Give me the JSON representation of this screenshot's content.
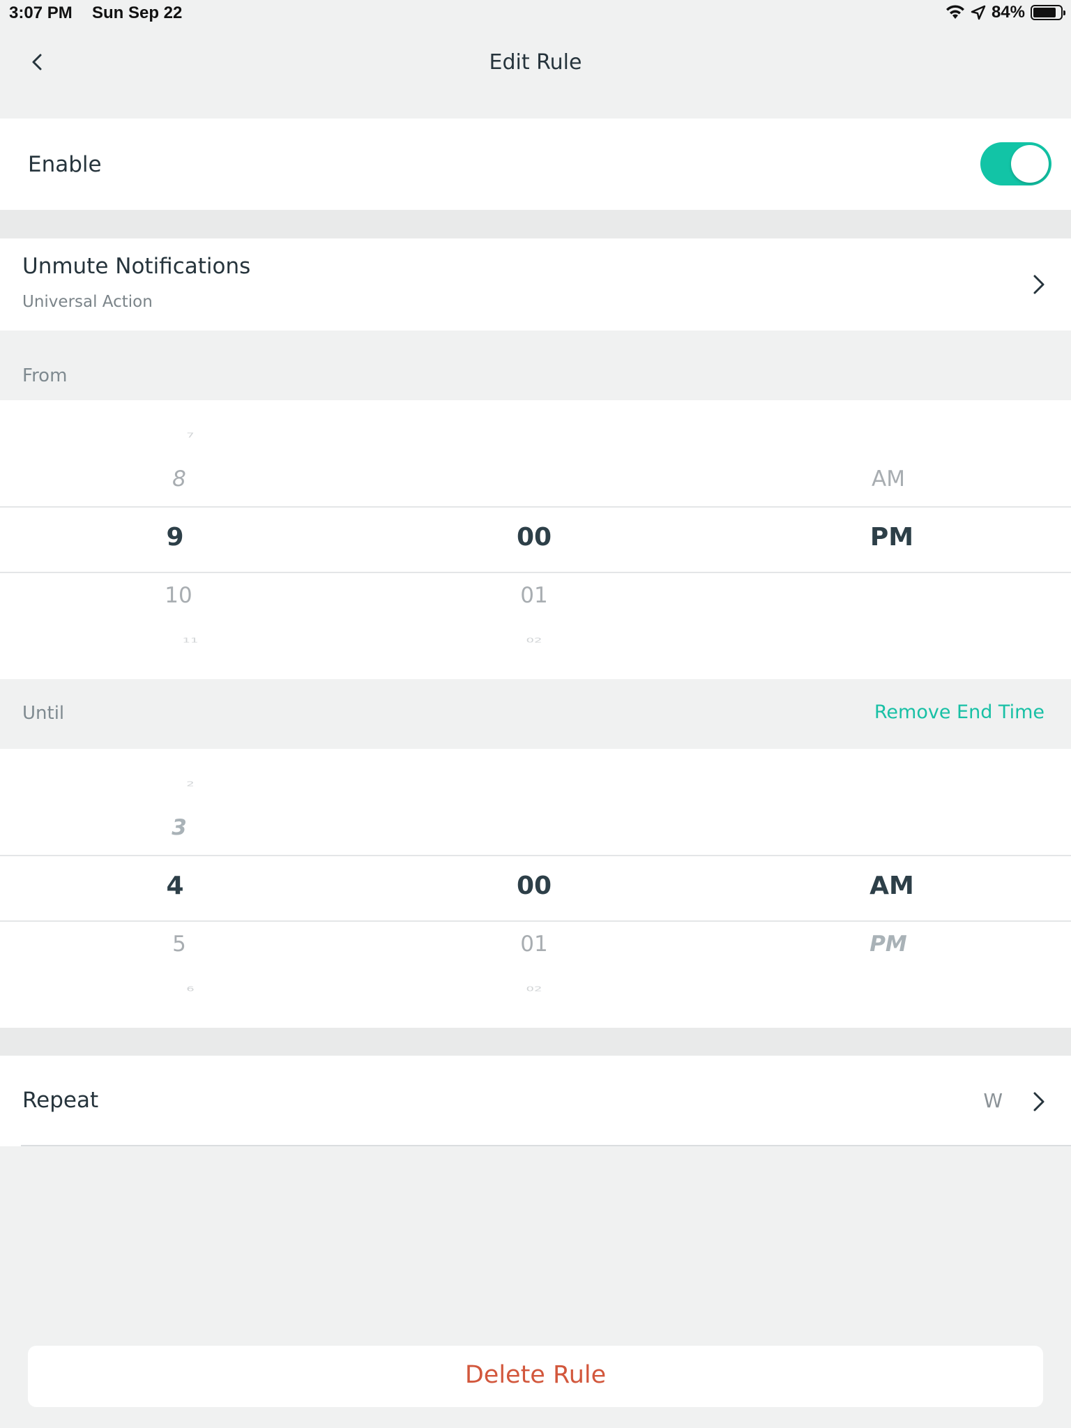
{
  "status_bar": {
    "time": "3:07 PM",
    "date": "Sun Sep 22",
    "battery": "84%",
    "icons": [
      "wifi-icon",
      "location-arrow-icon",
      "battery-icon"
    ]
  },
  "nav": {
    "title": "Edit Rule",
    "back_icon": "chevron-left-icon"
  },
  "enable": {
    "label": "Enable",
    "toggle_on": true,
    "toggle_color": "#12c4a6"
  },
  "action": {
    "title": "Unmute Notifications",
    "subtitle": "Universal Action"
  },
  "from": {
    "label": "From",
    "hours": {
      "far_above": "7",
      "above": "8",
      "selected": "9",
      "below": "10",
      "far_below": "11"
    },
    "minutes": {
      "selected": "00",
      "below": "01",
      "far_below": "02"
    },
    "period": {
      "above": "AM",
      "selected": "PM"
    }
  },
  "until": {
    "label": "Until",
    "remove_label": "Remove End Time",
    "hours": {
      "far_above": "2",
      "above": "3",
      "selected": "4",
      "below": "5",
      "far_below": "6"
    },
    "minutes": {
      "selected": "00",
      "below": "01",
      "far_below": "02"
    },
    "period": {
      "selected": "AM",
      "below": "PM"
    }
  },
  "repeat": {
    "label": "Repeat",
    "value": "W"
  },
  "delete": {
    "label": "Delete Rule",
    "color": "#d2573c"
  },
  "colors": {
    "accent": "#12c4a6",
    "background": "#f0f1f1",
    "text": "#26343c",
    "danger": "#d2573c"
  }
}
